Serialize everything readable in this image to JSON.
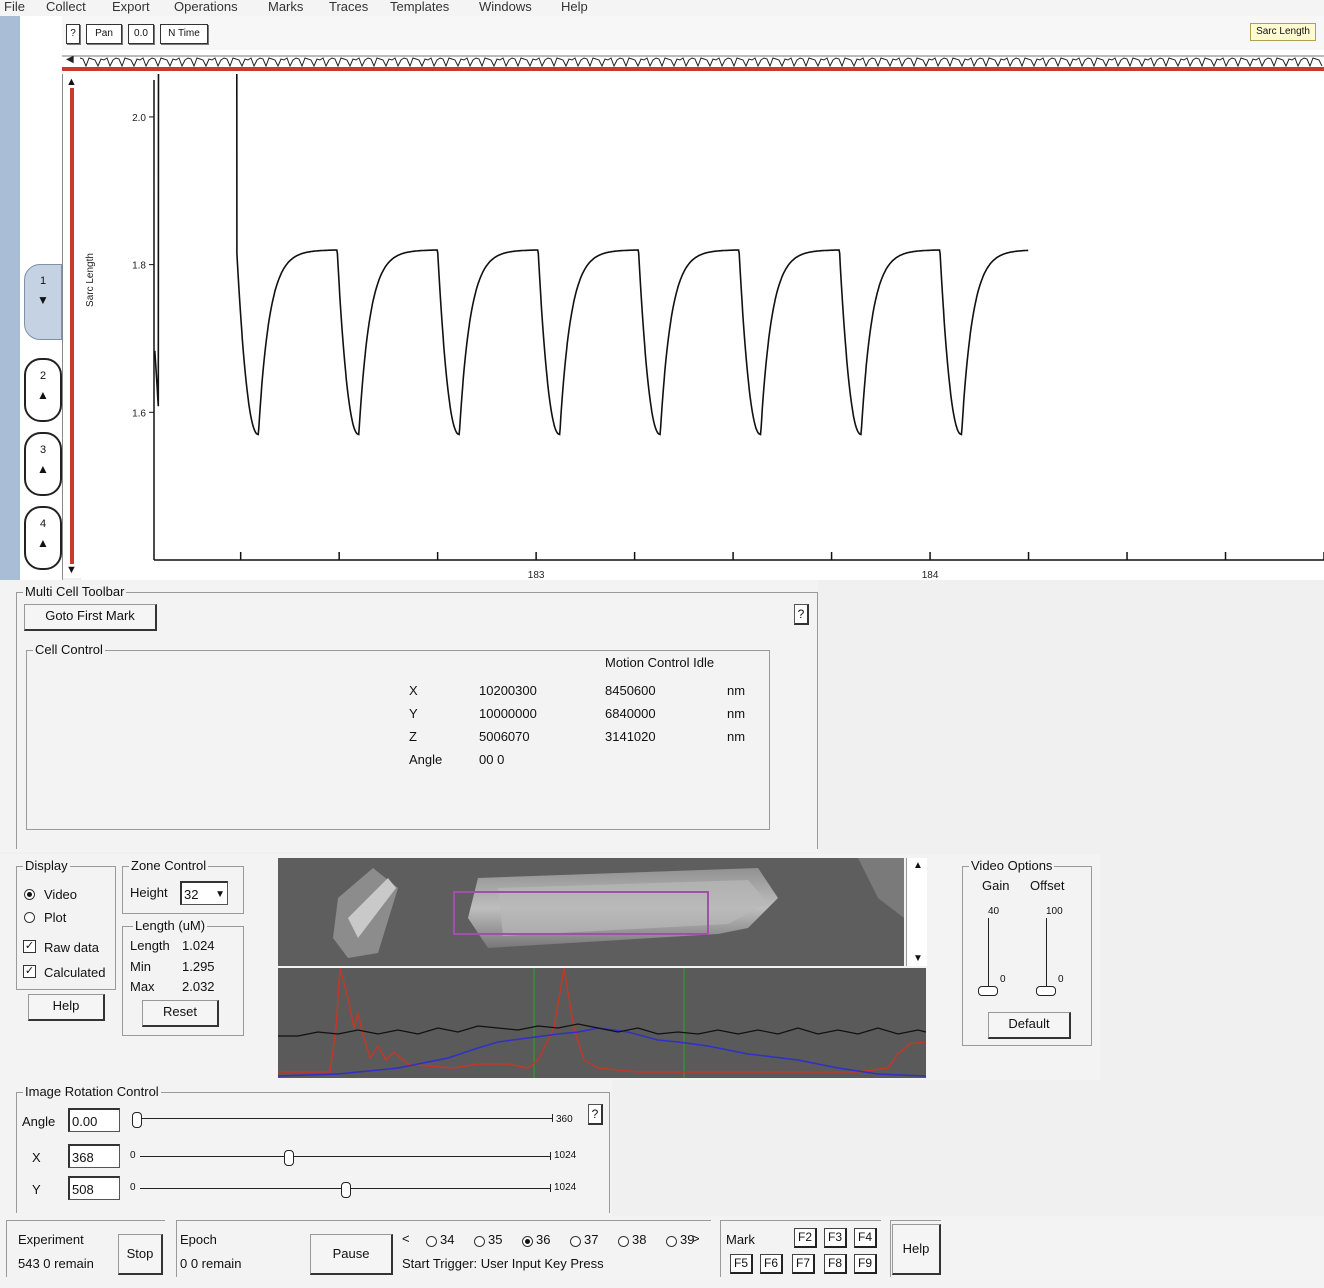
{
  "menu": [
    "File",
    "Collect",
    "Export",
    "Operations",
    "Marks",
    "Traces",
    "Templates",
    "Windows",
    "Help"
  ],
  "toolbar": {
    "buttons": [
      "?",
      "Pan",
      "0.0",
      "N Time"
    ],
    "cursor_label": "Sarc Length"
  },
  "side_tabs": [
    {
      "num": "1",
      "arrow": "▼"
    },
    {
      "num": "2",
      "arrow": "▲"
    },
    {
      "num": "3",
      "arrow": "▲"
    },
    {
      "num": "4",
      "arrow": "▲"
    }
  ],
  "chart_data": {
    "type": "line",
    "ylabel": "Sarc Length",
    "ytick_labels": [
      "2.0",
      "1.8",
      "1.6"
    ],
    "xtick_labels": [
      "183",
      "184"
    ],
    "xtick_values": [
      183,
      184
    ],
    "ylim": [
      1.4,
      2.05
    ],
    "xlim": [
      182.03,
      185.0
    ],
    "twitch_period": 0.255,
    "first_twitch_onset": 182.24,
    "baseline": 1.82,
    "trough": 1.57,
    "twitches": 8,
    "trace_end": 184.25,
    "series": [
      {
        "values": [
          1.82,
          1.57,
          1.82,
          1.57,
          1.82,
          1.57,
          1.82,
          1.57,
          1.82,
          1.57,
          1.82,
          1.57,
          1.82,
          1.57,
          1.82,
          1.57,
          1.82
        ]
      }
    ],
    "grid": false,
    "color": "#111111"
  },
  "multicell": {
    "title": "Multi Cell Toolbar",
    "button": "Goto First Mark",
    "help": "?",
    "cell_control": {
      "title": "Cell Control",
      "motion_header": "Motion Control Idle",
      "rows": [
        {
          "label": "X",
          "v1": "10200300",
          "v2": "8450600",
          "unit": "nm"
        },
        {
          "label": "Y",
          "v1": "10000000",
          "v2": "6840000",
          "unit": "nm"
        },
        {
          "label": "Z",
          "v1": "5006070",
          "v2": "3141020",
          "unit": "nm"
        },
        {
          "label": "Angle",
          "v1": "00 0",
          "v2": "",
          "unit": ""
        }
      ]
    }
  },
  "display": {
    "title": "Display",
    "options": [
      {
        "label": "Video",
        "checked": true
      },
      {
        "label": "Plot",
        "checked": false
      }
    ],
    "checks": [
      {
        "label": "Raw data",
        "checked": true
      },
      {
        "label": "Calculated",
        "checked": true
      }
    ],
    "help_button": "Help"
  },
  "zone": {
    "title": "Zone Control",
    "height_label": "Height",
    "height_value": "32"
  },
  "length": {
    "title": "Length (uM)",
    "rows": [
      {
        "label": "Length",
        "value": "1.024"
      },
      {
        "label": "Min",
        "value": "1.295"
      },
      {
        "label": "Max",
        "value": "2.032"
      }
    ],
    "reset_button": "Reset"
  },
  "video_options": {
    "title": "Video Options",
    "gain_label": "Gain",
    "offset_label": "Offset",
    "gain_max": "40",
    "offset_max": "100",
    "gain_min": "0",
    "offset_min": "0",
    "gain_level": 0.05,
    "offset_level": 0.05,
    "default_button": "Default"
  },
  "rotation": {
    "title": "Image Rotation Control",
    "help": "?",
    "rows": [
      {
        "label": "Angle",
        "value": "0.00",
        "min": "",
        "max": "360",
        "level": 0.0
      },
      {
        "label": "X",
        "value": "368",
        "min": "0",
        "max": "1024",
        "level": 0.36
      },
      {
        "label": "Y",
        "value": "508",
        "min": "0",
        "max": "1024",
        "level": 0.5
      }
    ]
  },
  "status": {
    "experiment_label": "Experiment",
    "experiment_value": "543 0 remain",
    "stop_button": "Stop",
    "epoch_label": "Epoch",
    "epoch_value": "0 0 remain",
    "pause_button": "Pause",
    "rate_prev": "<",
    "rate_next": ">",
    "rates": [
      {
        "label": "34",
        "checked": false
      },
      {
        "label": "35",
        "checked": false
      },
      {
        "label": "36",
        "checked": true
      },
      {
        "label": "37",
        "checked": false
      },
      {
        "label": "38",
        "checked": false
      },
      {
        "label": "39",
        "checked": false
      }
    ],
    "trigger_text": "Start Trigger: User Input Key Press",
    "mark_label": "Mark",
    "mark_keys_top": [
      "F2",
      "F3",
      "F4"
    ],
    "mark_keys_bottom": [
      "F5",
      "F6",
      "F7",
      "F8",
      "F9"
    ],
    "help_button": "Help"
  }
}
